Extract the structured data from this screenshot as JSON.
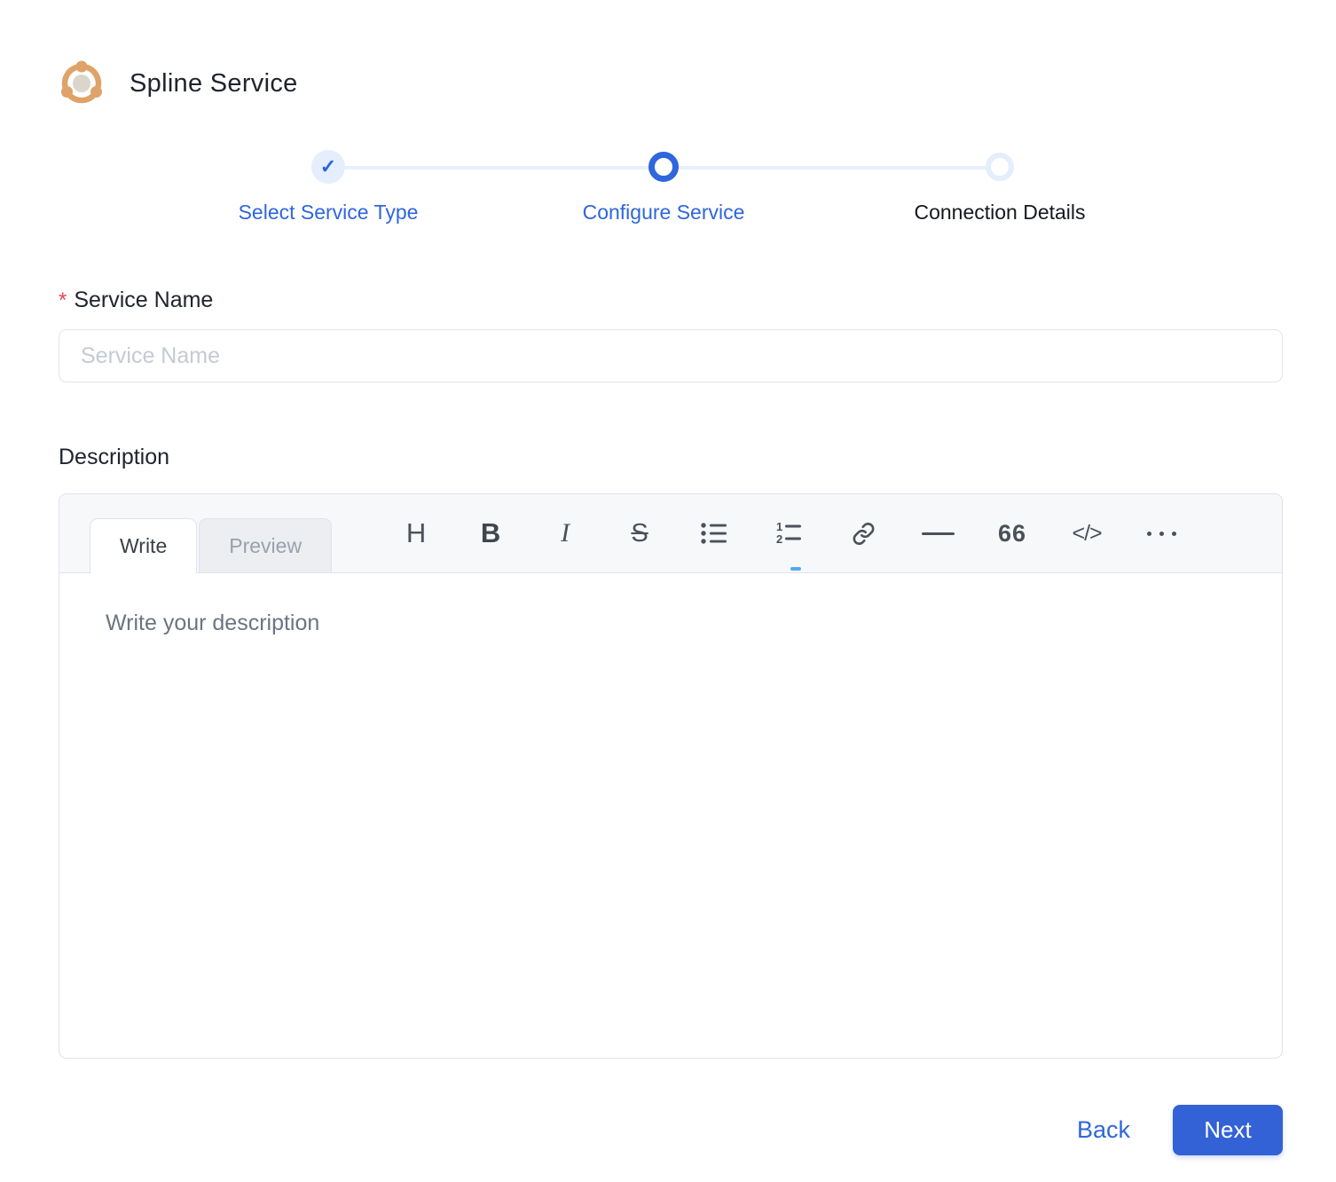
{
  "header": {
    "title": "Spline Service"
  },
  "stepper": {
    "steps": [
      {
        "label": "Select Service Type",
        "state": "completed",
        "check_glyph": "✓"
      },
      {
        "label": "Configure Service",
        "state": "active"
      },
      {
        "label": "Connection Details",
        "state": "upcoming"
      }
    ]
  },
  "form": {
    "service_name": {
      "label": "Service Name",
      "required_marker": "*",
      "placeholder": "Service Name",
      "value": ""
    },
    "description": {
      "label": "Description",
      "tabs": {
        "write": "Write",
        "preview": "Preview"
      },
      "placeholder": "Write your description",
      "value": "",
      "toolbar": {
        "heading_glyph": "H",
        "bold_glyph": "B",
        "italic_glyph": "I",
        "strikethrough_glyph": "S",
        "quote_glyph": "66",
        "code_glyph": "</>",
        "icons": [
          "heading",
          "bold",
          "italic",
          "strikethrough",
          "unordered-list",
          "ordered-list",
          "link",
          "horizontal-rule",
          "quote",
          "code",
          "more"
        ]
      }
    }
  },
  "footer": {
    "back_label": "Back",
    "next_label": "Next"
  },
  "colors": {
    "accent_blue": "#2F66DC",
    "light_blue": "#E4EEFC",
    "required_red": "#E5484D",
    "logo_orange": "#DFA268",
    "logo_center_gray": "#DCD5CB",
    "next_button_blue": "#3362D6",
    "toolbar_bg": "#F7F8FA"
  }
}
